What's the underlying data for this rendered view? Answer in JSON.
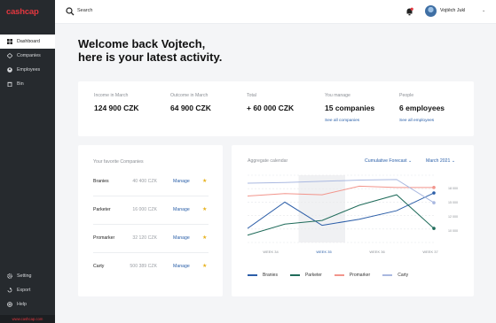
{
  "app": {
    "logo": "cashcap",
    "footer_link": "www.cashcap.com"
  },
  "sidebar": {
    "items": [
      {
        "label": "Dashboard",
        "icon": "dashboard-icon",
        "active": true
      },
      {
        "label": "Companies",
        "icon": "companies-icon"
      },
      {
        "label": "Employees",
        "icon": "employees-icon"
      },
      {
        "label": "Bin",
        "icon": "bin-icon"
      }
    ],
    "bottom": [
      {
        "label": "Setting",
        "icon": "gear-icon"
      },
      {
        "label": "Export",
        "icon": "export-icon"
      },
      {
        "label": "Help",
        "icon": "help-icon"
      }
    ]
  },
  "topbar": {
    "search_placeholder": "Search",
    "user_name": "Vojtěch Jukl",
    "notification_badge_color": "#e2373f"
  },
  "welcome": {
    "line1": "Welcome back Vojtech,",
    "line2": "here is your latest activity."
  },
  "stats": [
    {
      "label": "Income in March",
      "value": "124 900 CZK",
      "link": ""
    },
    {
      "label": "Outcome in March",
      "value": "64 900 CZK",
      "link": ""
    },
    {
      "label": "Total",
      "value": "+ 60 000 CZK",
      "link": ""
    },
    {
      "label": "You manage",
      "value": "15 companies",
      "link": "See all companies"
    },
    {
      "label": "People",
      "value": "6 employees",
      "link": "See all employees"
    }
  ],
  "favorites": {
    "title": "Your favorite Companies",
    "manage_label": "Manage",
    "rows": [
      {
        "name": "Branies",
        "amount": "40 400 CZK"
      },
      {
        "name": "Parketer",
        "amount": "16 000 CZK"
      },
      {
        "name": "Promarker",
        "amount": "32 120 CZK"
      },
      {
        "name": "Carty",
        "amount": "500 389 CZK"
      }
    ]
  },
  "aggregate": {
    "title": "Aggregate calendar",
    "forecast_label": "Cumulative Forecast",
    "month_label": "March 2021",
    "accent": "#2a5fa8"
  },
  "chart_data": {
    "type": "line",
    "x": [
      "WEEK 34",
      "WEEK 35",
      "WEEK 36",
      "WEEK 37"
    ],
    "selected_week": "WEEK 35",
    "y_tick_labels": [
      "18 000",
      "15 000",
      "12 000",
      "10 000"
    ],
    "series": [
      {
        "name": "Branies",
        "color": "#2c5ea8",
        "values": [
          11300,
          15600,
          11800,
          12800,
          14200,
          17100
        ]
      },
      {
        "name": "Parketer",
        "color": "#1f6b5a",
        "values": [
          10200,
          12000,
          12600,
          15100,
          16800,
          11300
        ]
      },
      {
        "name": "Promarker",
        "color": "#f2958c",
        "values": [
          16600,
          17000,
          16800,
          18200,
          18000,
          18000
        ]
      },
      {
        "name": "Carty",
        "color": "#a9b8e0",
        "values": [
          18700,
          18800,
          19000,
          19200,
          19300,
          15500
        ]
      }
    ]
  }
}
